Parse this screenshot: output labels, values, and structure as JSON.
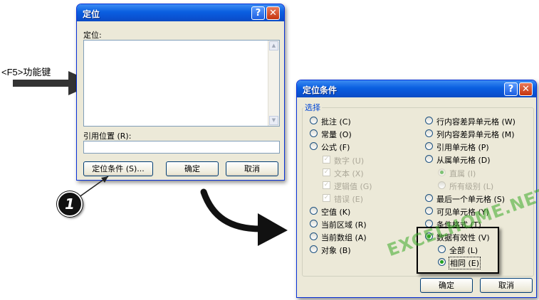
{
  "annotation": {
    "key_label": "<F5>功能键",
    "step_number": "1",
    "watermark": "EXCELHOME.NET"
  },
  "goto_dialog": {
    "title": "定位",
    "help_glyph": "?",
    "close_glyph": "✕",
    "list_label": "定位:",
    "ref_label": "引用位置 (R):",
    "ref_value": "",
    "special_button": "定位条件 (S)...",
    "ok_button": "确定",
    "cancel_button": "取消"
  },
  "special_dialog": {
    "title": "定位条件",
    "help_glyph": "?",
    "close_glyph": "✕",
    "group_label": "选择",
    "left_options": [
      {
        "label": "批注 (C)",
        "selected": false
      },
      {
        "label": "常量 (O)",
        "selected": false
      },
      {
        "label": "公式 (F)",
        "selected": false
      }
    ],
    "formula_subs": [
      {
        "label": "数字 (U)",
        "checked": true
      },
      {
        "label": "文本 (X)",
        "checked": true
      },
      {
        "label": "逻辑值 (G)",
        "checked": true
      },
      {
        "label": "错误 (E)",
        "checked": true
      }
    ],
    "left_options2": [
      {
        "label": "空值 (K)",
        "selected": false
      },
      {
        "label": "当前区域 (R)",
        "selected": false
      },
      {
        "label": "当前数组 (A)",
        "selected": false
      },
      {
        "label": "对象 (B)",
        "selected": false
      }
    ],
    "right_options": [
      {
        "label": "行内容差异单元格 (W)",
        "selected": false
      },
      {
        "label": "列内容差异单元格 (M)",
        "selected": false
      },
      {
        "label": "引用单元格 (P)",
        "selected": false
      },
      {
        "label": "从属单元格 (D)",
        "selected": false
      }
    ],
    "dep_subs": [
      {
        "label": "直属 (I)",
        "selected": true
      },
      {
        "label": "所有级别 (L)",
        "selected": false
      }
    ],
    "right_options2": [
      {
        "label": "最后一个单元格 (S)",
        "selected": false
      },
      {
        "label": "可见单元格 (Y)",
        "selected": false
      },
      {
        "label": "条件格式 (T)",
        "selected": false
      },
      {
        "label": "数据有效性 (V)",
        "selected": true
      }
    ],
    "validation_subs": [
      {
        "label": "全部 (L)",
        "selected": false
      },
      {
        "label": "相同 (E)",
        "selected": true
      }
    ],
    "ok_button": "确定",
    "cancel_button": "取消"
  }
}
